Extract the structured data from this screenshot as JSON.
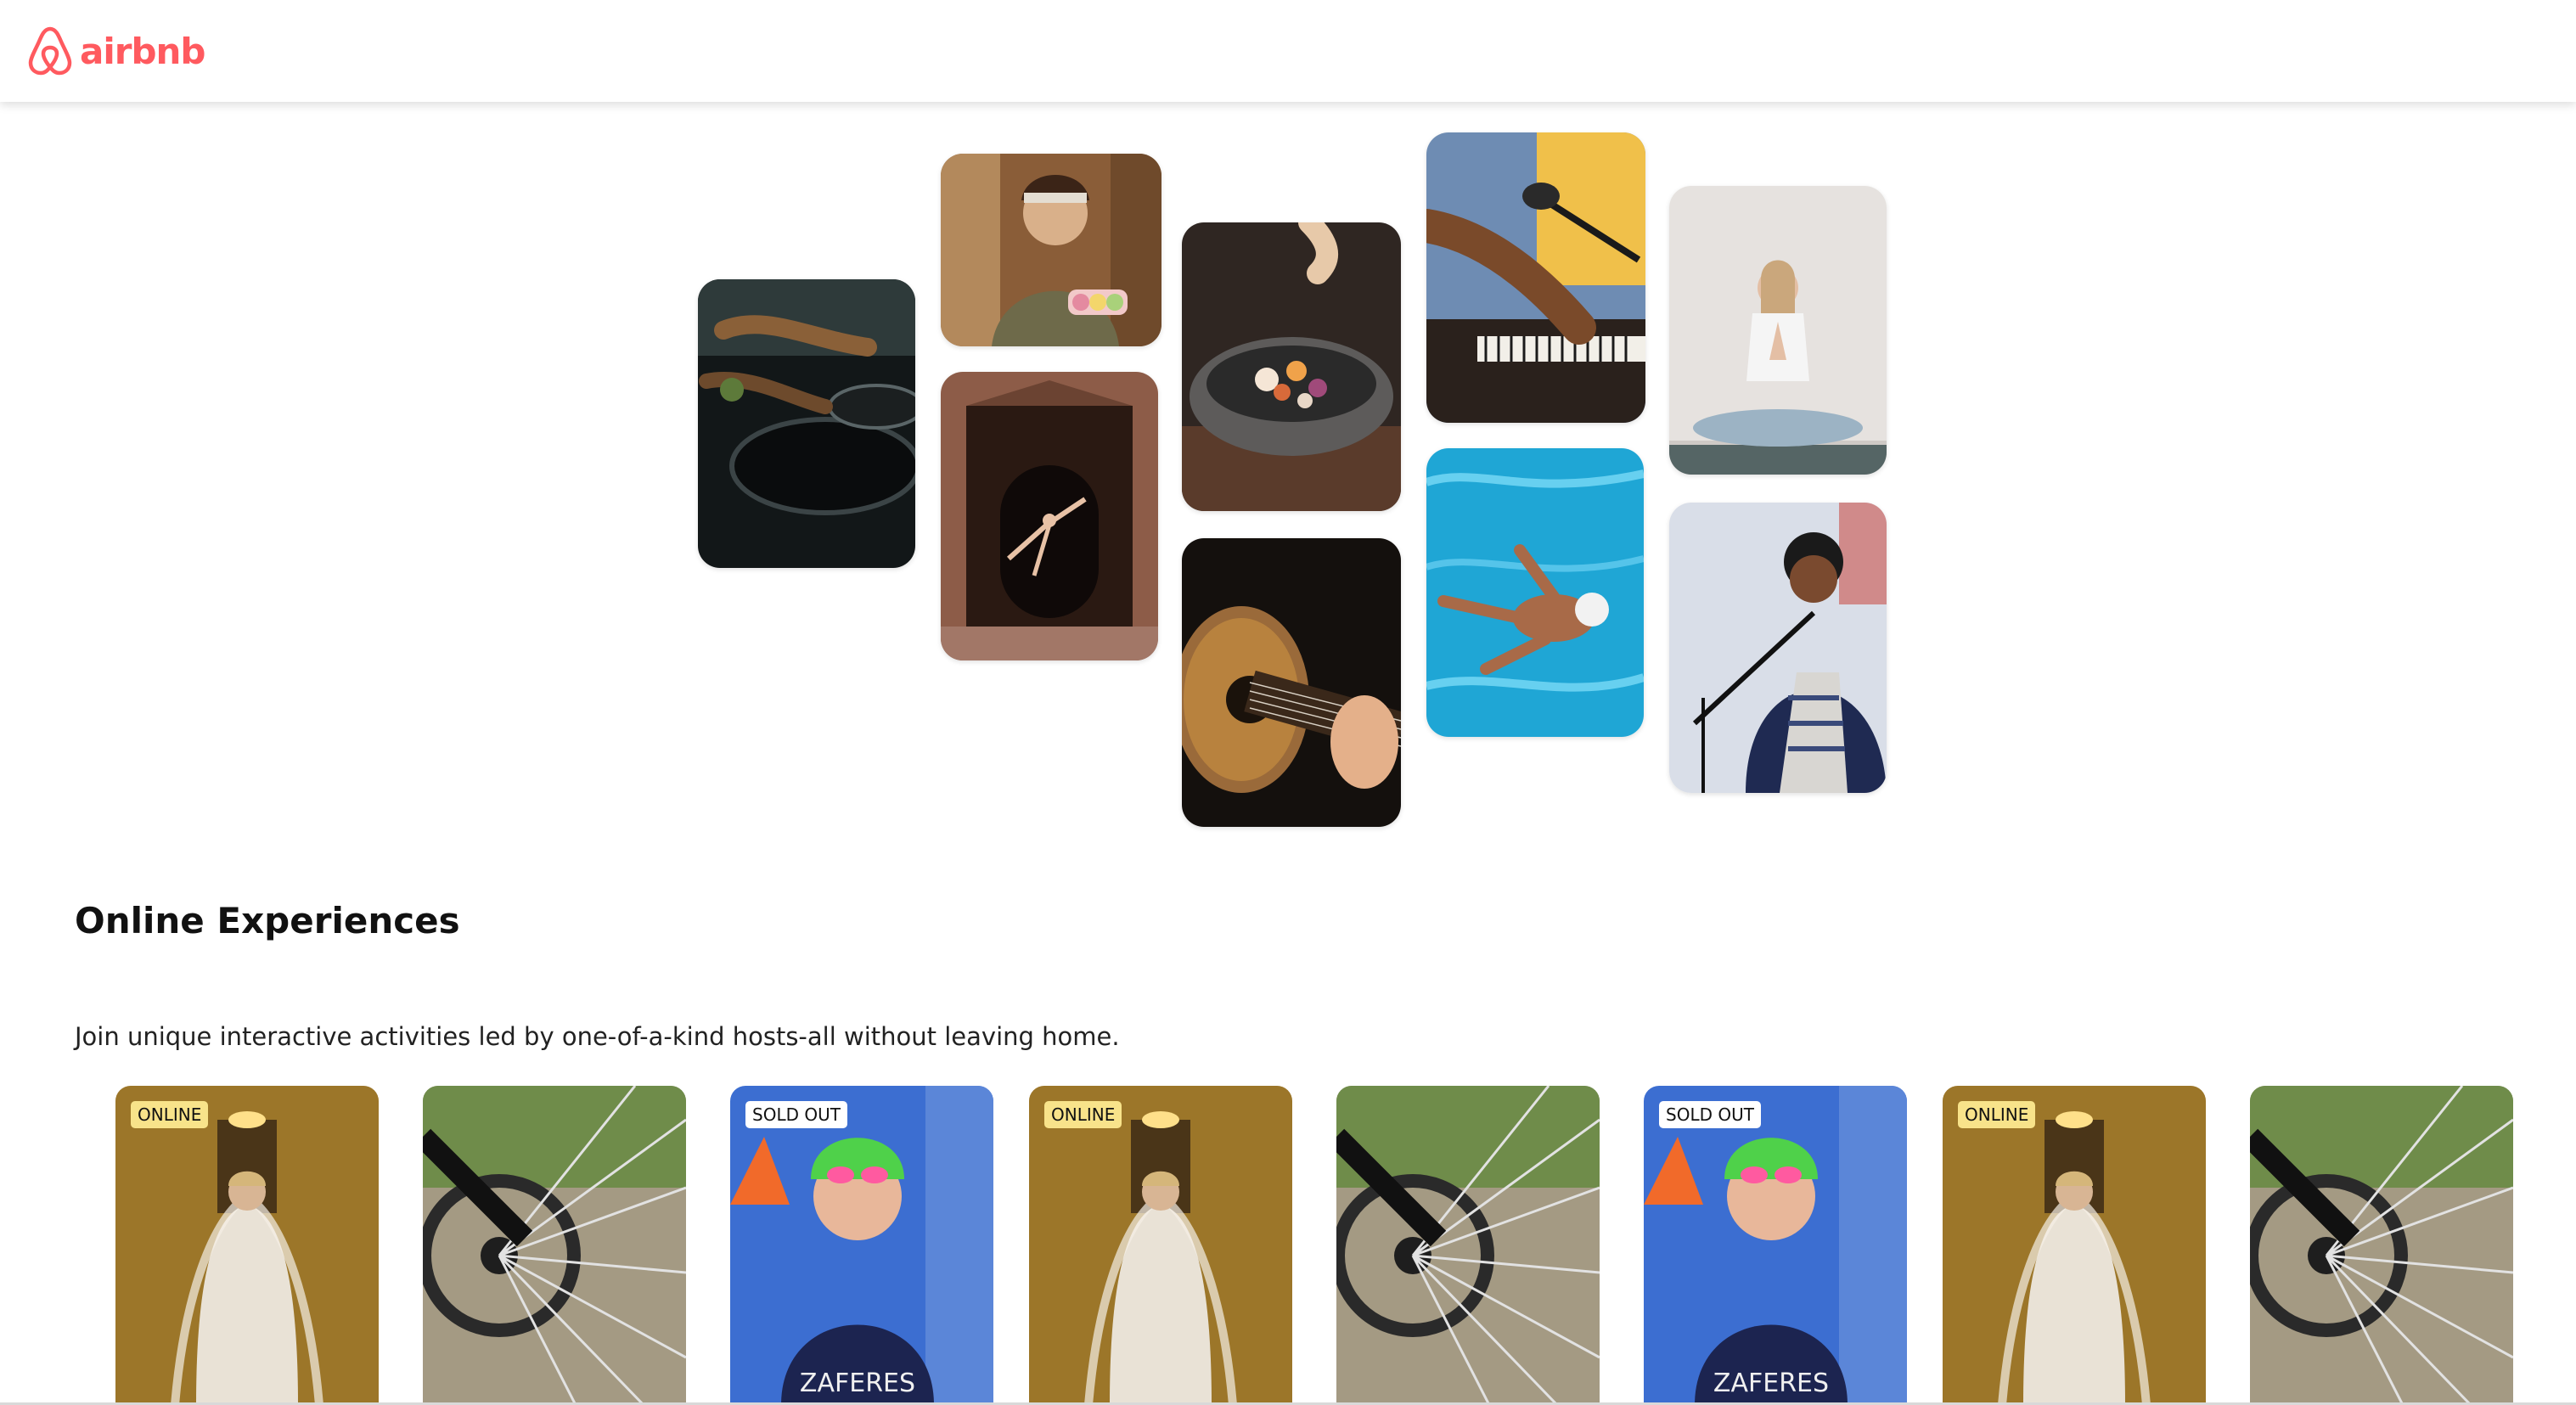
{
  "brand": {
    "name": "airbnb",
    "color": "#ff5a5f",
    "icon": "airbnb-logo-icon"
  },
  "hero": {
    "photos": [
      {
        "subject": "cooking-pans",
        "colors": [
          "#1f2a2b",
          "#0c0f10",
          "#6b4d2f"
        ]
      },
      {
        "subject": "woman-with-macarons",
        "colors": [
          "#b07a4a",
          "#6b4a2b",
          "#e7c9a4"
        ]
      },
      {
        "subject": "dancer-in-doorway",
        "colors": [
          "#8a5a45",
          "#2b1a14",
          "#c9927a"
        ]
      },
      {
        "subject": "food-bowl",
        "colors": [
          "#3a2b26",
          "#6f6f6f",
          "#d9b79b"
        ]
      },
      {
        "subject": "guitar",
        "colors": [
          "#1a1410",
          "#5b3a1e",
          "#b98852"
        ]
      },
      {
        "subject": "piano-and-microphone",
        "colors": [
          "#f0c04a",
          "#5b7ea8",
          "#2a211c"
        ]
      },
      {
        "subject": "swimmer",
        "colors": [
          "#1ea3d2",
          "#58c7ea",
          "#0d6f9a"
        ]
      },
      {
        "subject": "yoga",
        "colors": [
          "#e7e3e0",
          "#cfcac7",
          "#a9a4a0"
        ]
      },
      {
        "subject": "singer",
        "colors": [
          "#d8dde8",
          "#2b3b68",
          "#8fa0c8"
        ]
      }
    ]
  },
  "section": {
    "title": "Online Experiences",
    "subtitle": "Join unique interactive activities led by one-of-a-kind hosts-all without leaving home."
  },
  "cards": [
    {
      "subject": "bride",
      "badge": "ONLINE",
      "badge_type": "online"
    },
    {
      "subject": "bicycle-wheel",
      "badge": "",
      "badge_type": ""
    },
    {
      "subject": "swimmer-athlete",
      "badge": "SOLD OUT",
      "badge_type": "soldout"
    },
    {
      "subject": "bride",
      "badge": "ONLINE",
      "badge_type": "online"
    },
    {
      "subject": "bicycle-wheel",
      "badge": "",
      "badge_type": ""
    },
    {
      "subject": "swimmer-athlete",
      "badge": "SOLD OUT",
      "badge_type": "soldout"
    },
    {
      "subject": "bride",
      "badge": "ONLINE",
      "badge_type": "online"
    },
    {
      "subject": "bicycle-wheel",
      "badge": "",
      "badge_type": ""
    }
  ]
}
